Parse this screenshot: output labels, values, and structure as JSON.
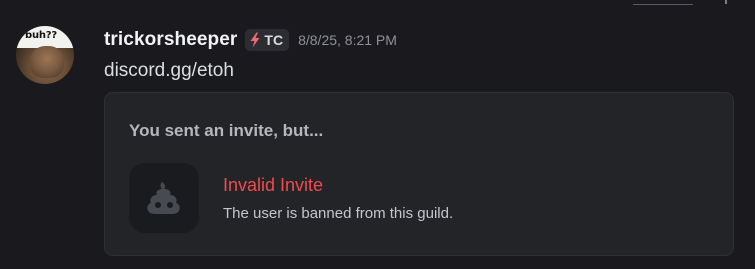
{
  "message": {
    "author": {
      "username": "trickorsheeper",
      "avatar_text": "buh??",
      "server_tag": "TC",
      "server_tag_icon": "lightning-bolt-icon"
    },
    "timestamp": "8/8/25, 8:21 PM",
    "content": "discord.gg/etoh"
  },
  "invite_embed": {
    "header": "You sent an invite, but...",
    "icon": "poop-icon",
    "title": "Invalid Invite",
    "description": "The user is banned from this guild."
  },
  "colors": {
    "background": "#1a1a1e",
    "card_background": "#232428",
    "error_red": "#f04b4f",
    "tag_bolt": "#ef6a6e"
  }
}
